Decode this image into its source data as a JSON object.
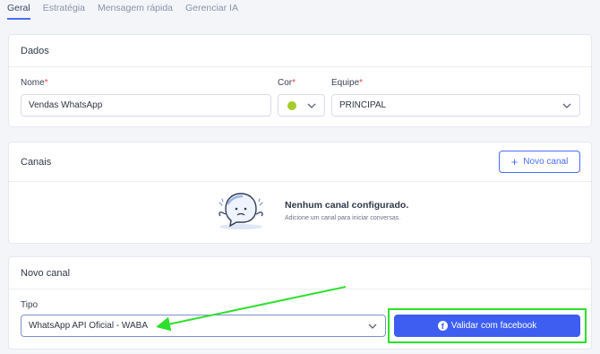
{
  "tabs": [
    {
      "label": "Geral",
      "active": true
    },
    {
      "label": "Estratégia",
      "active": false
    },
    {
      "label": "Mensagem rápida",
      "active": false
    },
    {
      "label": "Gerenciar IA",
      "active": false
    }
  ],
  "dados": {
    "title": "Dados",
    "nome_label": "Nome",
    "nome_value": "Vendas WhatsApp",
    "cor_label": "Cor",
    "cor_value_color": "#a6cc2a",
    "equipe_label": "Equipe",
    "equipe_value": "PRINCIPAL",
    "required_mark": "*"
  },
  "canais": {
    "title": "Canais",
    "novo_canal_button": "Novo canal",
    "empty_title": "Nenhum canal configurado.",
    "empty_subtitle": "Adicione um canal para iniciar conversas."
  },
  "novo_canal": {
    "title": "Novo canal",
    "tipo_label": "Tipo",
    "tipo_value": "WhatsApp API Oficial - WABA",
    "validate_button": "Validar com facebook"
  },
  "colors": {
    "accent": "#3d5ef0",
    "highlight": "#2de02d"
  }
}
